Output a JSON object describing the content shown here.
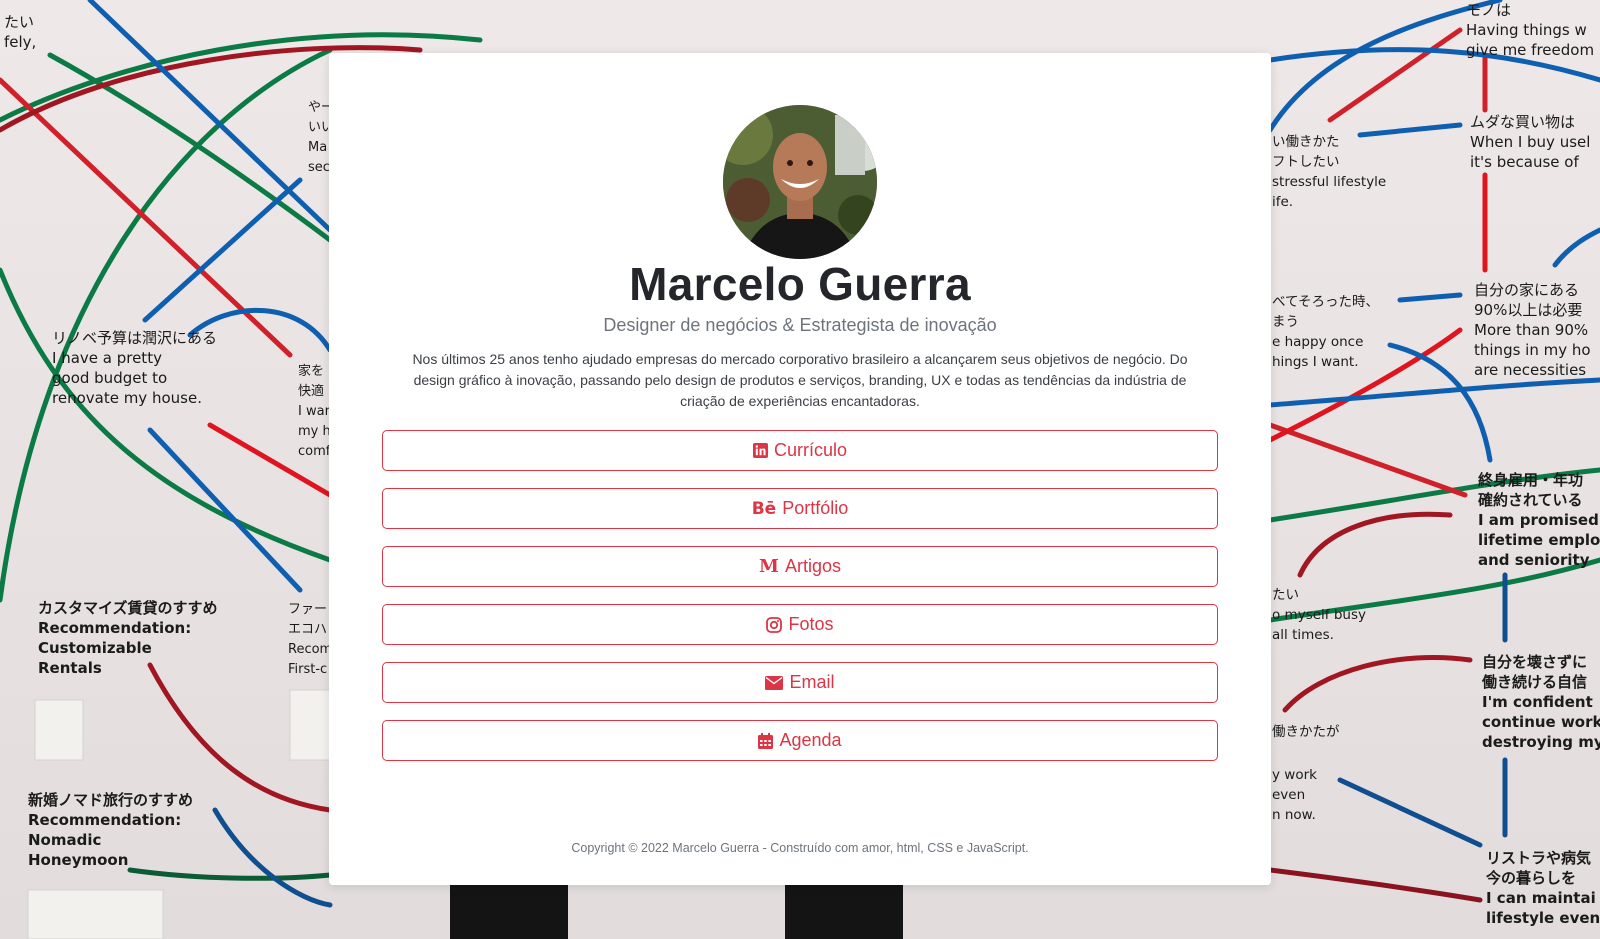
{
  "profile": {
    "name": "Marcelo Guerra",
    "subtitle": "Designer de negócios & Estrategista de inovação",
    "bio": "Nos últimos 25 anos tenho ajudado empresas do mercado corporativo brasileiro a alcançarem seus objetivos de negócio. Do design gráfico à inovação, passando pelo design de produtos e serviços, branding, UX e todas as tendências da indústria de criação de experiências encantadoras."
  },
  "links": [
    {
      "label": "Currículo",
      "icon": "linkedin-icon"
    },
    {
      "label": "Portfólio",
      "icon": "behance-icon"
    },
    {
      "label": "Artigos",
      "icon": "medium-icon"
    },
    {
      "label": "Fotos",
      "icon": "instagram-icon"
    },
    {
      "label": "Email",
      "icon": "envelope-icon"
    },
    {
      "label": "Agenda",
      "icon": "calendar-icon"
    }
  ],
  "footer": {
    "text": "Copyright © 2022 Marcelo Guerra - Construído com amor, html, CSS e JavaScript."
  },
  "background_text": {
    "left": [
      "たい",
      "fely,",
      "リノベ予算は潤沢にある",
      "I have a pretty",
      "good budget to",
      "renovate my house.",
      "カスタマイズ賃貸のすすめ",
      "Recommendation:",
      "Customizable",
      "Rentals",
      "新婚ノマド旅行のすすめ",
      "Recommendation:",
      "Nomadic",
      "Honeymoon",
      "ファー",
      "エコハ",
      "Recom",
      "First-c",
      "家を",
      "快適",
      "I war",
      "my h",
      "comf",
      "やー",
      "いい",
      "Ma",
      "sec"
    ],
    "right": [
      "モノは",
      "Having things w",
      "give me freedom",
      "ムダな買い物は",
      "When I buy usel",
      "it's because of",
      "い働きかた",
      "フトしたい",
      "stressful lifestyle",
      "ife.",
      "自分の家にある",
      "90%以上は必要",
      "More than 90%",
      "things in my ho",
      "are necessities",
      "べてそろった時、",
      "まう",
      "e happy once",
      "hings I want.",
      "終身雇用・年功",
      "確約されている",
      "I am promised",
      "lifetime emplo",
      "and seniority",
      "たい",
      "o myself busy",
      "all times.",
      "自分を壊さずに",
      "働き続ける自信",
      "I'm confident",
      "continue work",
      "destroying my",
      "働きかたが",
      "y work",
      "even",
      "n now.",
      "リストラや病気",
      "今の暮らしを",
      "I can maintai",
      "lifestyle even"
    ]
  },
  "colors": {
    "accent": "#dc3545",
    "title": "#24262b",
    "muted": "#6d747c",
    "card": "#ffffff"
  }
}
